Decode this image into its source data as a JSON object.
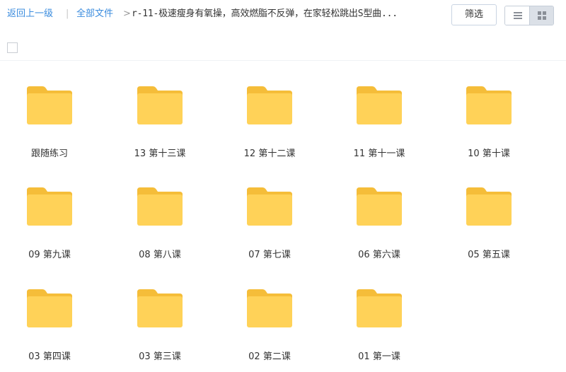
{
  "breadcrumb": {
    "back_label": "返回上一级",
    "separator": "|",
    "root_label": "全部文件",
    "arrow": ">",
    "current_label": "r-11-极速瘦身有氧操，高效燃脂不反弹，在家轻松跳出S型曲..."
  },
  "toolbar": {
    "filter_label": "筛选",
    "view_mode": "grid"
  },
  "colors": {
    "link": "#3b8cde",
    "folder_body": "#ffd258",
    "folder_tab": "#f5bd39"
  },
  "folders": [
    {
      "name": "跟随练习"
    },
    {
      "name": "13 第十三课"
    },
    {
      "name": "12 第十二课"
    },
    {
      "name": "11 第十一课"
    },
    {
      "name": "10 第十课"
    },
    {
      "name": "09 第九课"
    },
    {
      "name": "08 第八课"
    },
    {
      "name": "07 第七课"
    },
    {
      "name": "06 第六课"
    },
    {
      "name": "05 第五课"
    },
    {
      "name": "03 第四课"
    },
    {
      "name": "03 第三课"
    },
    {
      "name": "02 第二课"
    },
    {
      "name": "01 第一课"
    }
  ]
}
